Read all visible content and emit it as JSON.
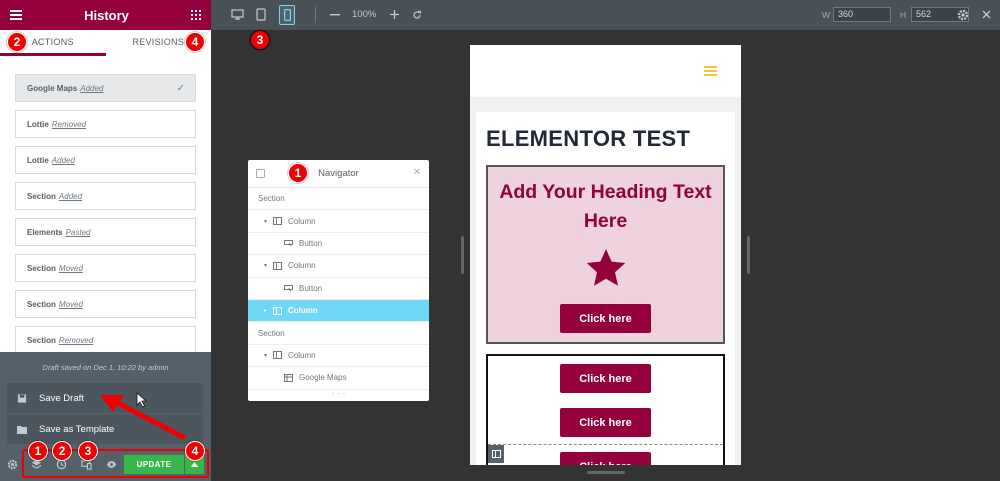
{
  "panel": {
    "title": "History",
    "tabs": [
      {
        "label": "ACTIONS"
      },
      {
        "label": "REVISIONS"
      }
    ]
  },
  "history": {
    "items": [
      {
        "name": "Google Maps",
        "action": "Added"
      },
      {
        "name": "Lottie",
        "action": "Removed"
      },
      {
        "name": "Lottie",
        "action": "Added"
      },
      {
        "name": "Section",
        "action": "Added"
      },
      {
        "name": "Elements",
        "action": "Pasted"
      },
      {
        "name": "Section",
        "action": "Moved"
      },
      {
        "name": "Section",
        "action": "Moved"
      },
      {
        "name": "Section",
        "action": "Removed"
      }
    ]
  },
  "save_menu": {
    "draft_note": "Draft saved on Dec 1, 10:22 by admin",
    "save_draft": "Save Draft",
    "save_template": "Save as Template"
  },
  "footer": {
    "update_label": "UPDATE"
  },
  "topbar": {
    "zoom": "100%",
    "width_label": "W",
    "width_value": "360",
    "height_label": "H",
    "height_value": "562"
  },
  "preview": {
    "page_title": "ELEMENTOR TEST",
    "heading": "Add Your Heading Text Here",
    "buttons": [
      {
        "label": "Click here"
      },
      {
        "label": "Click here"
      },
      {
        "label": "Click here"
      },
      {
        "label": "Click here"
      }
    ]
  },
  "navigator": {
    "title": "Navigator",
    "rows": [
      {
        "label": "Section",
        "indent": 0,
        "caret": "",
        "icon": "none"
      },
      {
        "label": "Column",
        "indent": 1,
        "caret": "▾",
        "icon": "column"
      },
      {
        "label": "Button",
        "indent": 2,
        "caret": "",
        "icon": "button"
      },
      {
        "label": "Column",
        "indent": 1,
        "caret": "▾",
        "icon": "column"
      },
      {
        "label": "Button",
        "indent": 2,
        "caret": "",
        "icon": "button"
      },
      {
        "label": "Column",
        "indent": 1,
        "caret": "▸",
        "icon": "column",
        "active": true
      },
      {
        "label": "Section",
        "indent": 0,
        "caret": "",
        "icon": "none"
      },
      {
        "label": "Column",
        "indent": 1,
        "caret": "▾",
        "icon": "column"
      },
      {
        "label": "Google Maps",
        "indent": 2,
        "caret": "",
        "icon": "map"
      }
    ]
  },
  "annotations": {
    "badges": [
      "1",
      "2",
      "3",
      "4",
      "1",
      "2",
      "3",
      "4"
    ]
  },
  "colors": {
    "brand": "#93003c",
    "update_green": "#39b54a",
    "nav_active": "#71d7f7",
    "annotation_red": "#e00000",
    "menu_yellow": "#f5c242"
  }
}
